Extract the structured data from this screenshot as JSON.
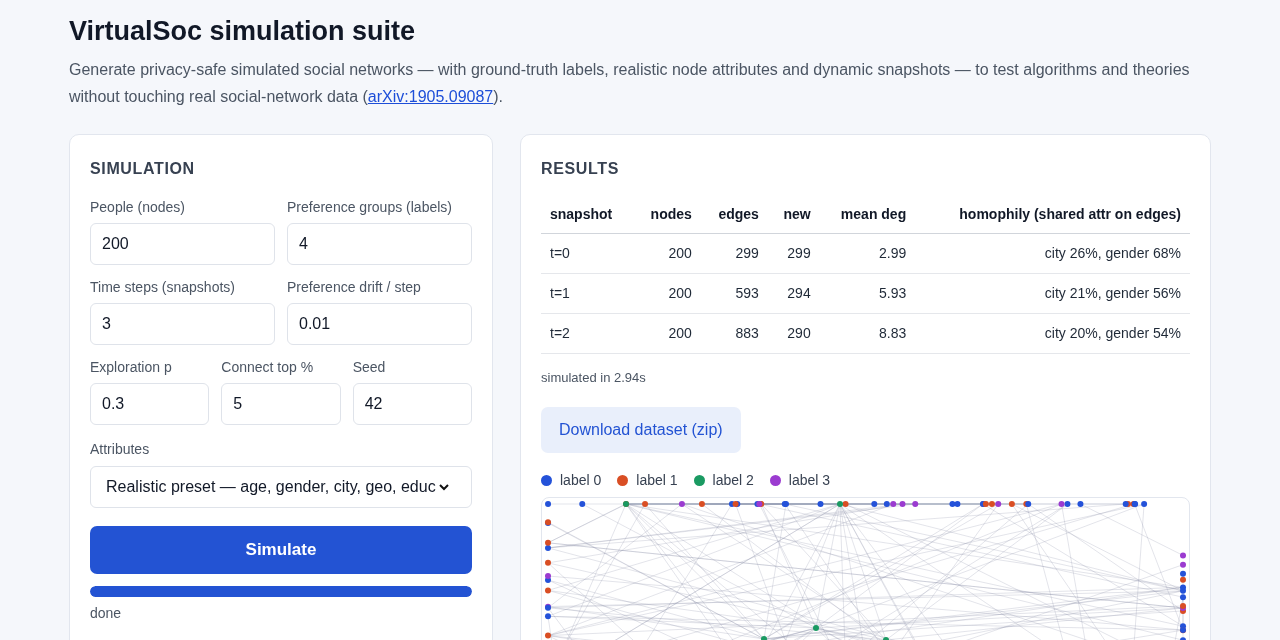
{
  "header": {
    "title": "VirtualSoc simulation suite",
    "description": "Generate privacy-safe simulated social networks — with ground-truth labels, realistic node attributes and dynamic snapshots — to test algorithms and theories without touching real social-network data (",
    "link": "arXiv:1905.09087",
    "description_end": ")."
  },
  "simulation": {
    "title": "SIMULATION",
    "field_rows": [
      [
        {
          "label": "People (nodes)",
          "value": "200"
        },
        {
          "label": "Preference groups (labels)",
          "value": "4"
        }
      ],
      [
        {
          "label": "Time steps (snapshots)",
          "value": "3"
        },
        {
          "label": "Preference drift / step",
          "value": "0.01"
        }
      ],
      [
        {
          "label": "Exploration p",
          "value": "0.3"
        },
        {
          "label": "Connect top %",
          "value": "5"
        },
        {
          "label": "Seed",
          "value": "42"
        }
      ]
    ],
    "attributes": {
      "label": "Attributes",
      "value": "Realistic preset — age, gender, city, geo, educ"
    },
    "button": "Simulate",
    "progress": {
      "level": 1
    },
    "status": "done"
  },
  "results": {
    "title": "RESULTS",
    "table": {
      "columns": [
        "snapshot",
        "nodes",
        "edges",
        "new",
        "mean deg",
        "homophily (shared attr on edges)"
      ],
      "rows": [
        [
          "t=0",
          "200",
          "299",
          "299",
          "2.99",
          "city 26%, gender 68%"
        ],
        [
          "t=1",
          "200",
          "593",
          "294",
          "5.93",
          "city 21%, gender 56%"
        ],
        [
          "t=2",
          "200",
          "883",
          "290",
          "8.83",
          "city 20%, gender 54%"
        ]
      ]
    },
    "timing": "simulated in 2.94s",
    "download": "Download dataset (zip)",
    "legend": [
      {
        "label": "label 0",
        "color": "#2452d9"
      },
      {
        "label": "label 1",
        "color": "#d94e24"
      },
      {
        "label": "label 2",
        "color": "#1a9a62"
      },
      {
        "label": "label 3",
        "color": "#9b3bd0"
      }
    ]
  }
}
